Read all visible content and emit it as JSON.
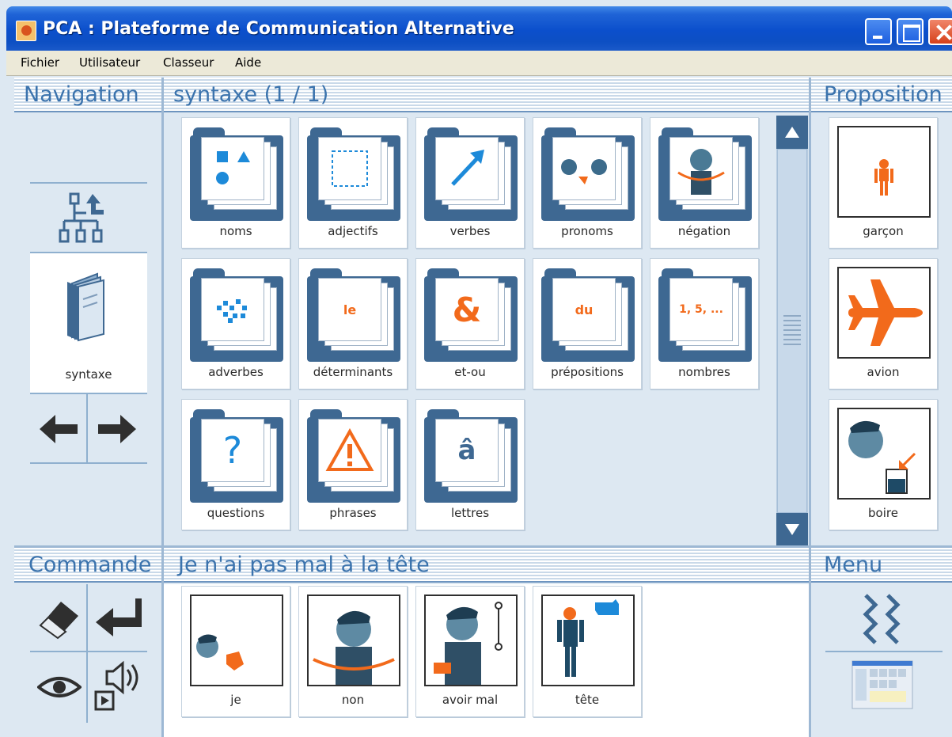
{
  "window": {
    "title": "PCA : Plateforme de Communication Alternative"
  },
  "menu": [
    "Fichier",
    "Utilisateur",
    "Classeur",
    "Aide"
  ],
  "navigation": {
    "header": "Navigation",
    "current_label": "syntaxe"
  },
  "main": {
    "header": "syntaxe (1 / 1)",
    "folders": [
      {
        "label": "noms",
        "glyph": "shapes-icon"
      },
      {
        "label": "adjectifs",
        "glyph": "dashed-square-icon"
      },
      {
        "label": "verbes",
        "glyph": "arrow-icon"
      },
      {
        "label": "pronoms",
        "glyph": "faces-icon"
      },
      {
        "label": "négation",
        "glyph": "head-shake-icon"
      },
      {
        "label": "adverbes",
        "glyph": "dots-icon"
      },
      {
        "label": "déterminants",
        "glyph": "le-icon"
      },
      {
        "label": "et-ou",
        "glyph": "ampersand-icon"
      },
      {
        "label": "prépositions",
        "glyph": "du-icon"
      },
      {
        "label": "nombres",
        "glyph": "numbers-icon"
      },
      {
        "label": "questions",
        "glyph": "question-icon"
      },
      {
        "label": "phrases",
        "glyph": "warning-icon"
      },
      {
        "label": "lettres",
        "glyph": "letter-icon"
      }
    ],
    "glyph_text": {
      "ampersand": "&",
      "question": "?",
      "letter": "â",
      "le": "le",
      "du": "du",
      "numbers": "1, 5, ..."
    }
  },
  "proposition": {
    "header": "Proposition",
    "items": [
      {
        "label": "garçon"
      },
      {
        "label": "avion"
      },
      {
        "label": "boire"
      }
    ]
  },
  "commande": {
    "header": "Commande"
  },
  "phrase": {
    "header": "Je n'ai pas mal à la tête",
    "words": [
      {
        "label": "je"
      },
      {
        "label": "non"
      },
      {
        "label": "avoir mal"
      },
      {
        "label": "tête"
      }
    ]
  },
  "menu_panel": {
    "header": "Menu"
  },
  "colors": {
    "accent": "#f26a1b",
    "folder": "#3e6892",
    "header_text": "#3b73ad",
    "panel_bg": "#dde8f2"
  }
}
